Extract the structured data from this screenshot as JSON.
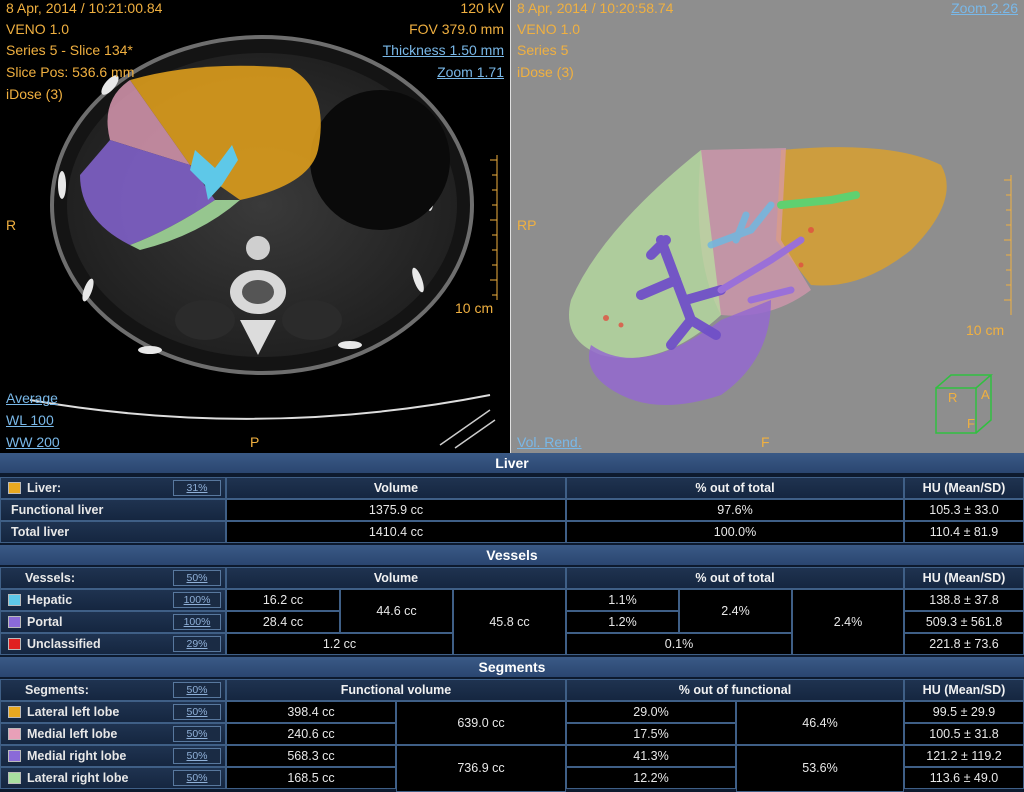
{
  "left_view": {
    "datetime": "8 Apr, 2014 / 10:21:00.84",
    "protocol": "VENO 1.0",
    "series": "Series 5 - Slice 134*",
    "slice_pos": "Slice Pos: 536.6 mm",
    "recon": "iDose (3)",
    "kv": "120 kV",
    "fov": "FOV 379.0 mm",
    "thickness": "Thickness 1.50 mm",
    "zoom": "Zoom 1.71",
    "orient_left": "R",
    "orient_bottom": "P",
    "scale": "10 cm",
    "mode": "Average",
    "wl": "WL  100",
    "ww": "WW  200"
  },
  "right_view": {
    "datetime": "8 Apr, 2014 / 10:20:58.74",
    "protocol": "VENO 1.0",
    "series": "Series 5",
    "recon": "iDose (3)",
    "zoom": "Zoom 2.26",
    "orient_left": "RP",
    "orient_bottom": "F",
    "scale": "10 cm",
    "mode": "Vol. Rend.",
    "cube_r": "R",
    "cube_a": "A",
    "cube_f": "F"
  },
  "colors": {
    "liver": "#e8a820",
    "hepatic": "#5ec8e8",
    "portal": "#8a6ad8",
    "unclassified": "#e02020",
    "lateral_left": "#e8a820",
    "medial_left": "#e8a0b8",
    "medial_right": "#8a6ad8",
    "lateral_right": "#a8e0a0"
  },
  "liver": {
    "title": "Liver",
    "label": "Liver:",
    "opacity": "31%",
    "col_volume": "Volume",
    "col_pct": "% out of total",
    "col_hu": "HU (Mean/SD)",
    "rows": [
      {
        "name": "Functional liver",
        "volume": "1375.9 cc",
        "pct": "97.6%",
        "hu": "105.3 ± 33.0"
      },
      {
        "name": "Total liver",
        "volume": "1410.4 cc",
        "pct": "100.0%",
        "hu": "110.4 ± 81.9"
      }
    ]
  },
  "vessels": {
    "title": "Vessels",
    "label": "Vessels:",
    "opacity": "50%",
    "col_volume": "Volume",
    "col_pct": "% out of total",
    "col_hu": "HU (Mean/SD)",
    "hepatic": {
      "name": "Hepatic",
      "opacity": "100%",
      "volume": "16.2 cc",
      "pct": "1.1%",
      "hu": "138.8 ± 37.8"
    },
    "portal": {
      "name": "Portal",
      "opacity": "100%",
      "volume": "28.4 cc",
      "pct": "1.2%",
      "hu": "509.3 ± 561.8"
    },
    "unclassified": {
      "name": "Unclassified",
      "opacity": "29%",
      "volume": "1.2 cc",
      "pct": "0.1%",
      "hu": "221.8 ± 73.6"
    },
    "hp_volume": "44.6 cc",
    "hp_pct": "2.4%",
    "total_volume": "45.8 cc",
    "total_pct": "2.4%"
  },
  "segments": {
    "title": "Segments",
    "label": "Segments:",
    "opacity": "50%",
    "col_volume": "Functional volume",
    "col_pct": "% out of functional",
    "col_hu": "HU (Mean/SD)",
    "rows": [
      {
        "name": "Lateral left lobe",
        "opacity": "50%",
        "volume": "398.4 cc",
        "pct": "29.0%",
        "hu": "99.5 ± 29.9"
      },
      {
        "name": "Medial left lobe",
        "opacity": "50%",
        "volume": "240.6 cc",
        "pct": "17.5%",
        "hu": "100.5 ± 31.8"
      },
      {
        "name": "Medial right lobe",
        "opacity": "50%",
        "volume": "568.3 cc",
        "pct": "41.3%",
        "hu": "121.2 ± 119.2"
      },
      {
        "name": "Lateral right lobe",
        "opacity": "50%",
        "volume": "168.5 cc",
        "pct": "12.2%",
        "hu": "113.6 ± 49.0"
      }
    ],
    "left_volume": "639.0 cc",
    "left_pct": "46.4%",
    "right_volume": "736.9 cc",
    "right_pct": "53.6%"
  }
}
